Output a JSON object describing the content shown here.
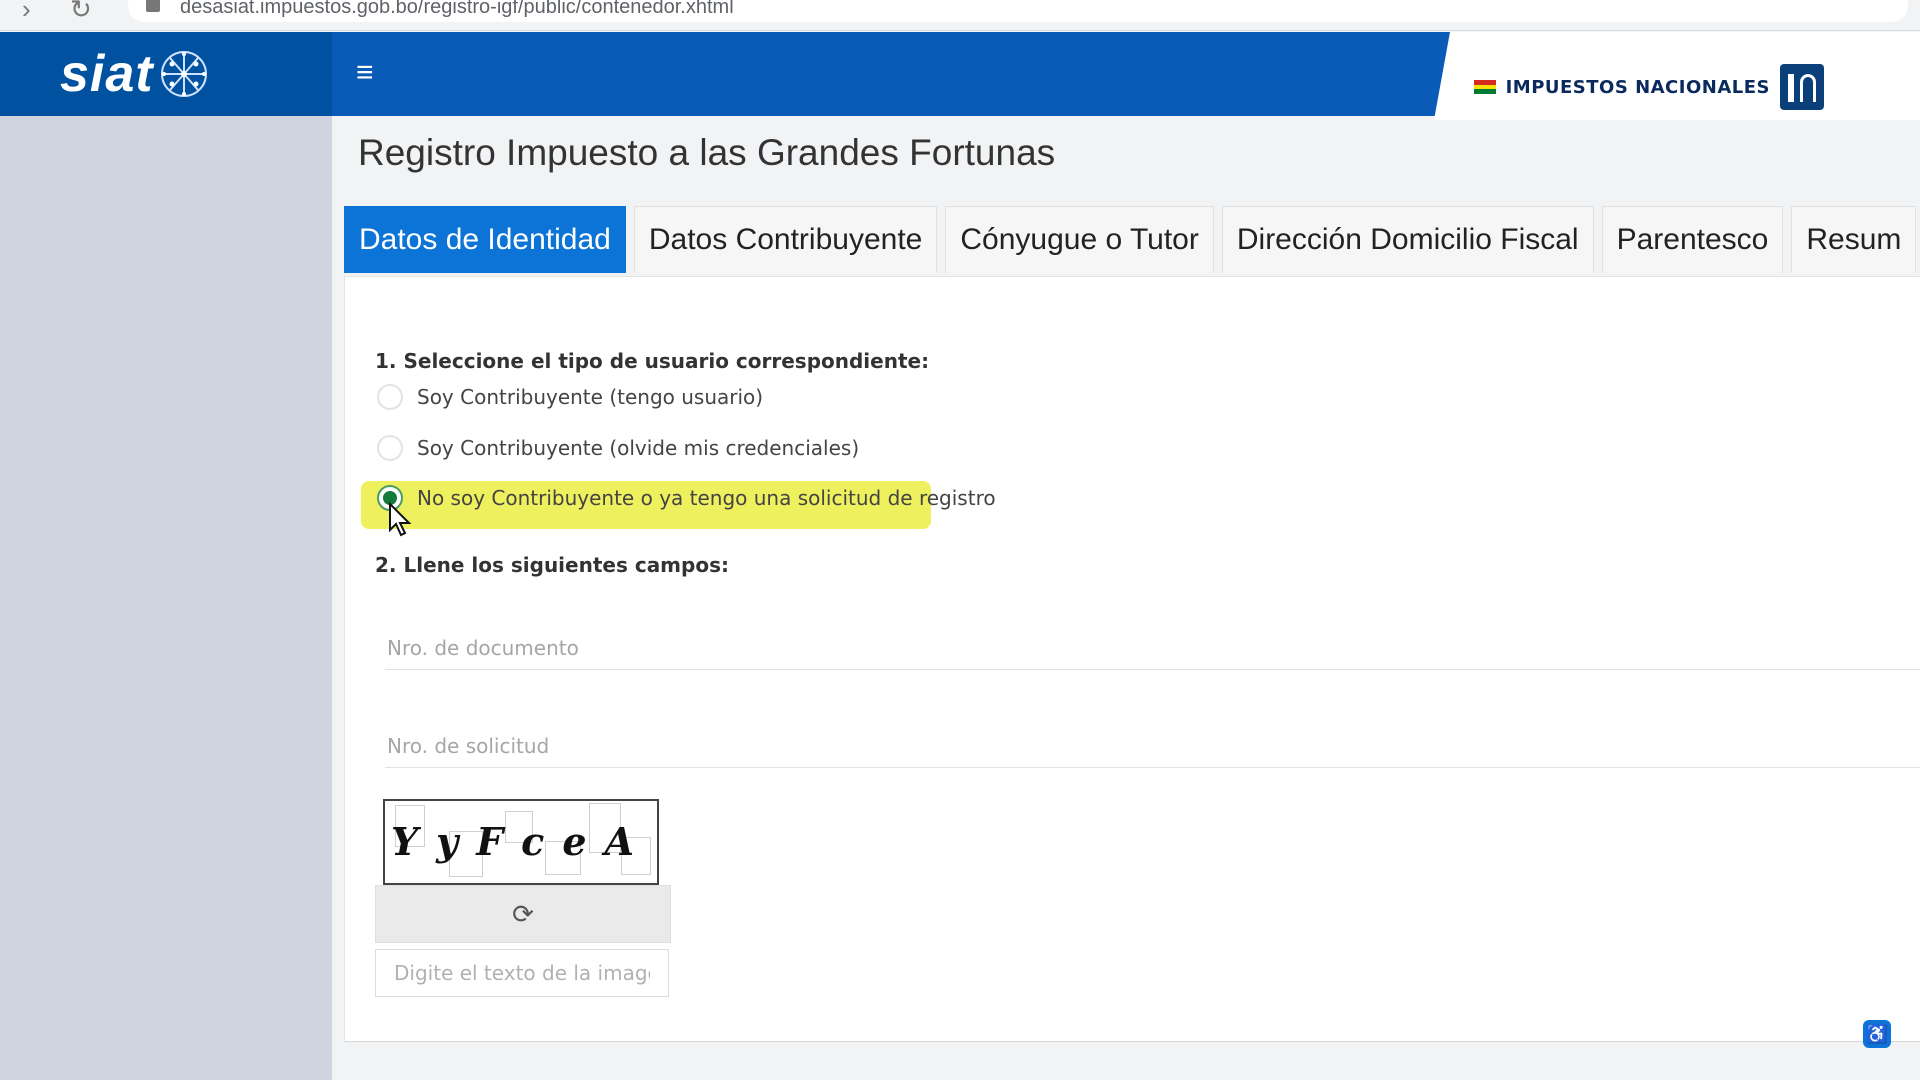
{
  "browser": {
    "url": "desasiat.impuestos.gob.bo/registro-igf/public/contenedor.xhtml"
  },
  "brand": {
    "logo_text": "siat"
  },
  "header": {
    "org_name": "IMPUESTOS NACIONALES",
    "flag_colors": [
      "#d52b1e",
      "#f9e300",
      "#007934"
    ]
  },
  "page": {
    "title": "Registro Impuesto a las Grandes Fortunas"
  },
  "tabs": [
    {
      "label": "Datos de Identidad",
      "active": true
    },
    {
      "label": "Datos Contribuyente",
      "active": false
    },
    {
      "label": "Cónyugue o Tutor",
      "active": false
    },
    {
      "label": "Dirección Domicilio Fiscal",
      "active": false
    },
    {
      "label": "Parentesco",
      "active": false
    },
    {
      "label": "Resum",
      "active": false
    }
  ],
  "step1": {
    "title": "1. Seleccione el tipo de usuario correspondiente:",
    "options": [
      {
        "label": "Soy Contribuyente (tengo usuario)",
        "selected": false
      },
      {
        "label": "Soy Contribuyente (olvide mis credenciales)",
        "selected": false
      },
      {
        "label": "No soy Contribuyente o ya tengo una solicitud de registro",
        "selected": true
      }
    ]
  },
  "step2": {
    "title": "2. Llene los siguientes campos:",
    "doc_placeholder": "Nro. de documento",
    "solicitud_placeholder": "Nro. de solicitud",
    "captcha_text": "YyFceA",
    "captcha_input_placeholder": "Digite el texto de la imagen"
  },
  "icons": {
    "menu": "hamburger-menu-icon",
    "refresh": "refresh-icon",
    "accessibility": "accessibility-icon"
  },
  "colors": {
    "brand_blue": "#0052a0",
    "header_blue": "#0a5bb8",
    "active_tab": "#0b74d6",
    "highlight": "#eef15d"
  }
}
